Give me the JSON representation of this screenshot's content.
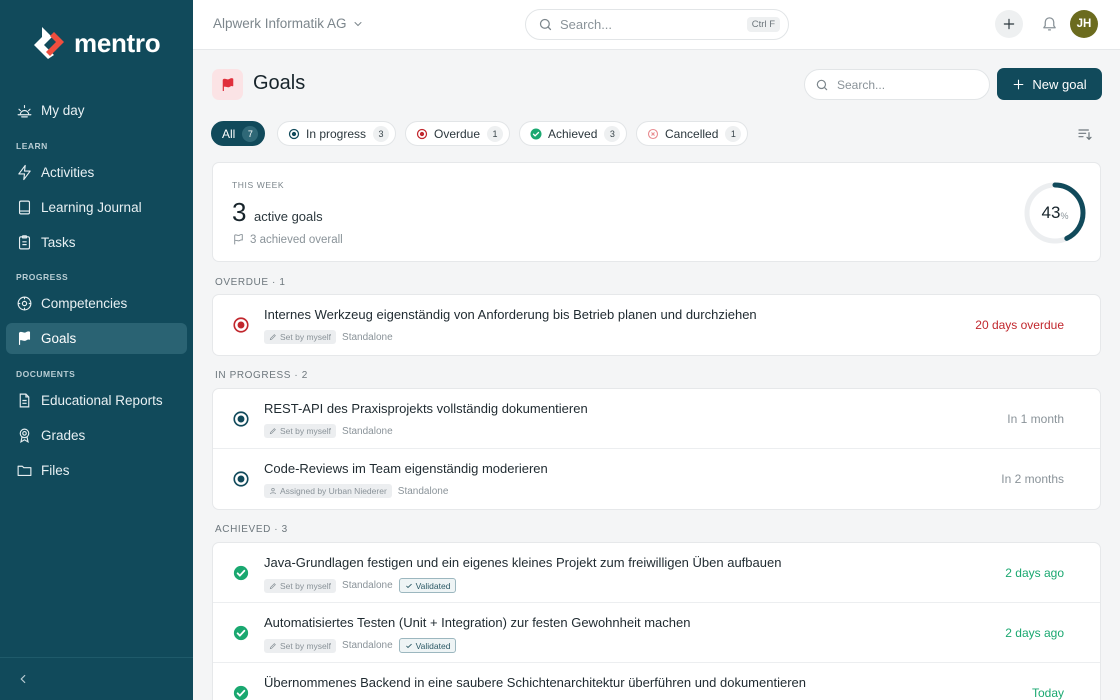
{
  "brand": {
    "name": "mentro",
    "accent": "#114a5b",
    "logo_color": "#f04e3e"
  },
  "sidebar": {
    "top_items": [
      {
        "label": "My day",
        "icon": "sunrise-icon"
      }
    ],
    "sections": [
      {
        "heading": "LEARN",
        "items": [
          {
            "label": "Activities",
            "icon": "activity-icon"
          },
          {
            "label": "Learning Journal",
            "icon": "book-icon"
          },
          {
            "label": "Tasks",
            "icon": "clipboard-icon"
          }
        ]
      },
      {
        "heading": "PROGRESS",
        "items": [
          {
            "label": "Competencies",
            "icon": "compass-icon"
          },
          {
            "label": "Goals",
            "icon": "flag-icon",
            "active": true
          }
        ]
      },
      {
        "heading": "DOCUMENTS",
        "items": [
          {
            "label": "Educational Reports",
            "icon": "document-icon"
          },
          {
            "label": "Grades",
            "icon": "award-icon"
          },
          {
            "label": "Files",
            "icon": "folder-icon"
          }
        ]
      }
    ]
  },
  "topbar": {
    "org_name": "Alpwerk Informatik AG",
    "search_placeholder": "Search...",
    "search_shortcut": "Ctrl F",
    "avatar_initials": "JH"
  },
  "page": {
    "title": "Goals",
    "search_placeholder": "Search...",
    "new_goal_label": "New goal"
  },
  "tabs": [
    {
      "label": "All",
      "count": "7",
      "active": true
    },
    {
      "label": "In progress",
      "count": "3"
    },
    {
      "label": "Overdue",
      "count": "1"
    },
    {
      "label": "Achieved",
      "count": "3"
    },
    {
      "label": "Cancelled",
      "count": "1"
    }
  ],
  "summary": {
    "label": "THIS WEEK",
    "count": "3",
    "count_text": "active goals",
    "sub": "3 achieved overall",
    "percent": 43,
    "percent_text": "43",
    "percent_unit": "%"
  },
  "groups": [
    {
      "label": "OVERDUE · 1",
      "goals": [
        {
          "title": "Internes Werkzeug eigenständig von Anforderung bis Betrieb planen und durchziehen",
          "source": "Set by myself",
          "type": "Standalone",
          "due": "20 days overdue"
        }
      ]
    },
    {
      "label": "IN PROGRESS · 2",
      "goals": [
        {
          "title": "REST-API des Praxisprojekts vollständig dokumentieren",
          "source": "Set by myself",
          "type": "Standalone",
          "due": "In 1 month"
        },
        {
          "title": "Code-Reviews im Team eigenständig moderieren",
          "source": "Assigned by Urban Niederer",
          "type": "Standalone",
          "due": "In 2 months"
        }
      ]
    },
    {
      "label": "ACHIEVED · 3",
      "goals": [
        {
          "title": "Java-Grundlagen festigen und ein eigenes kleines Projekt zum freiwilligen Üben aufbauen",
          "source": "Set by myself",
          "type": "Standalone",
          "badge": "Validated",
          "due": "2 days ago"
        },
        {
          "title": "Automatisiertes Testen (Unit + Integration) zur festen Gewohnheit machen",
          "source": "Set by myself",
          "type": "Standalone",
          "badge": "Validated",
          "due": "2 days ago"
        },
        {
          "title": "Übernommenes Backend in eine saubere Schichtenarchitektur überführen und dokumentieren",
          "due": "Today"
        }
      ]
    }
  ]
}
